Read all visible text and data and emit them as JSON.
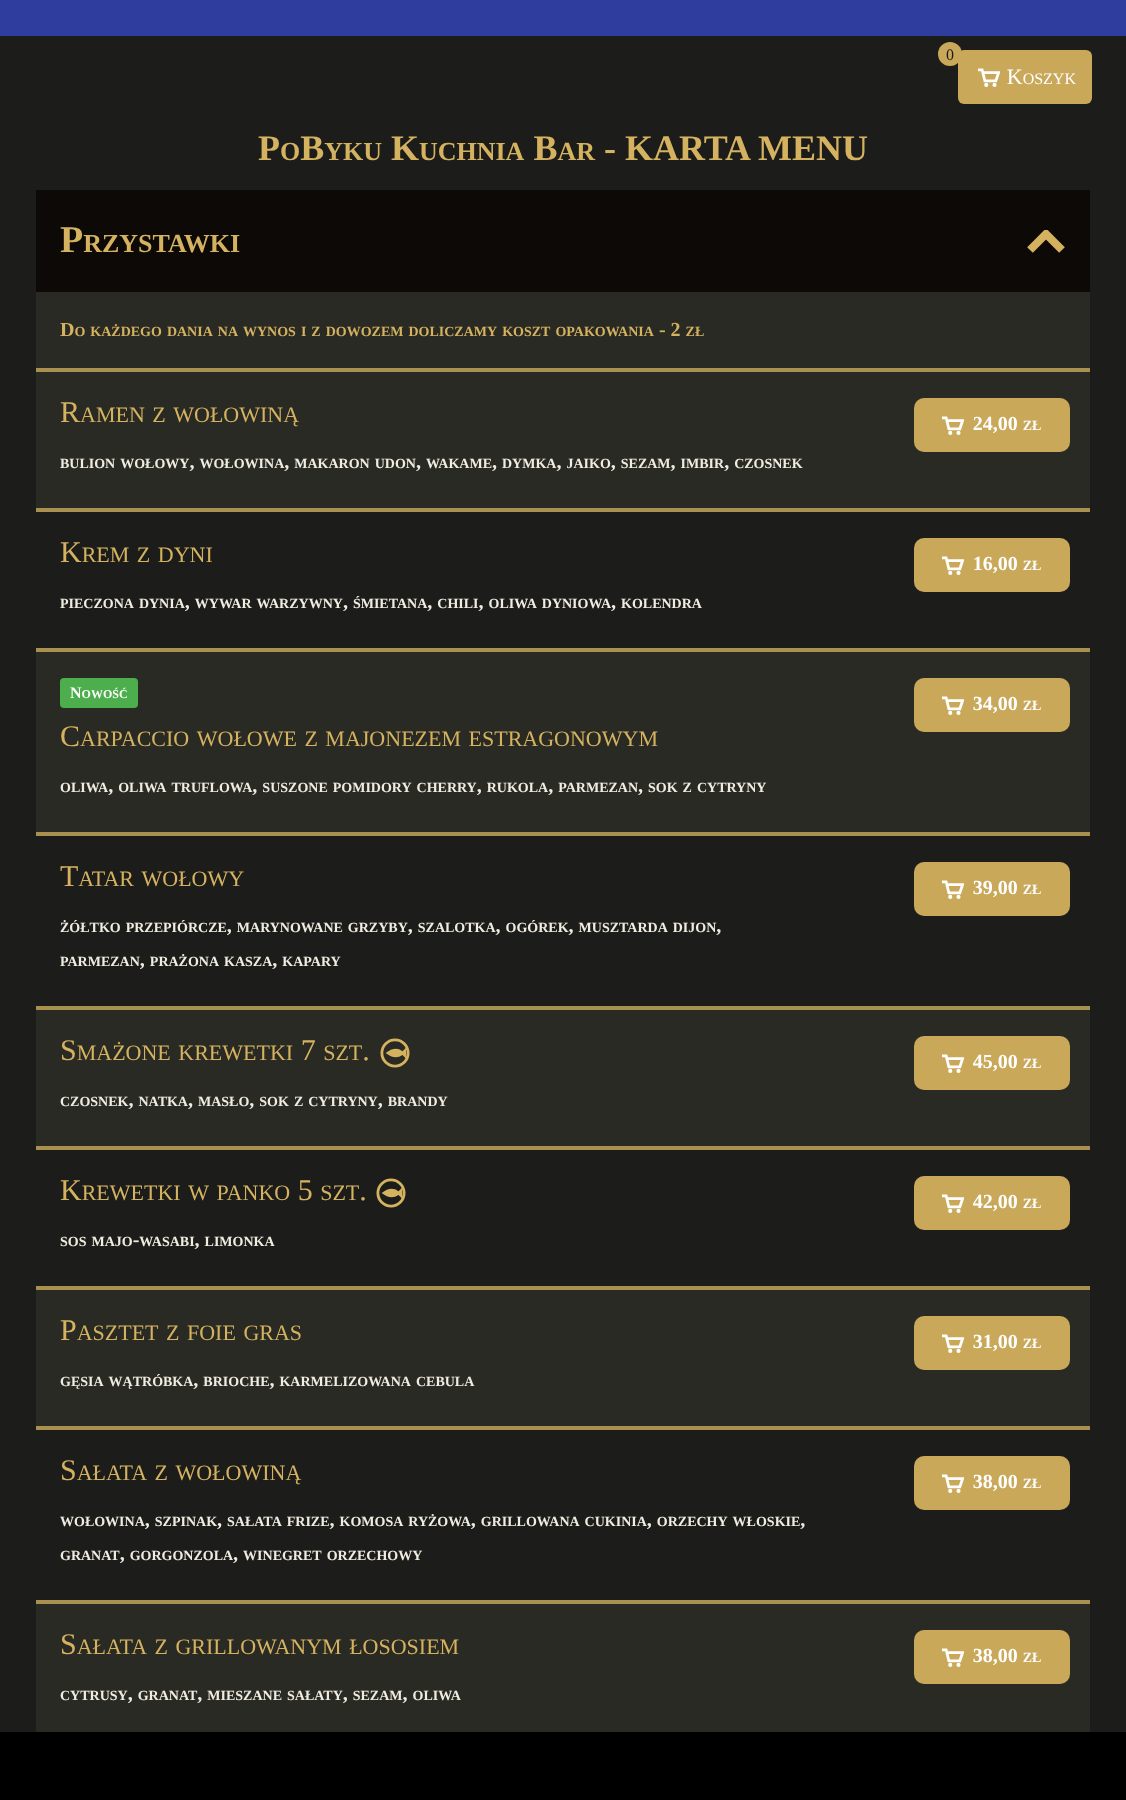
{
  "cart": {
    "count": "0",
    "label": "Koszyk"
  },
  "title": "PoByku Kuchnia Bar - KARTA MENU",
  "section": {
    "title": "Przystawki",
    "expanded": true,
    "notice": "Do każdego dania na wynos i z dowozem doliczamy koszt opakowania - 2 zł"
  },
  "items": [
    {
      "name": "Ramen z wołowiną",
      "ingredients": "bulion wołowy, wołowina, makaron udon, wakame, dymka, jaiko, sezam, imbir, czosnek",
      "price": "24,00 zł",
      "shrimp_icon": false
    },
    {
      "name": "Krem z dyni",
      "ingredients": "pieczona dynia, wywar warzywny, śmietana, chili, oliwa dyniowa, kolendra",
      "price": "16,00 zł",
      "shrimp_icon": false
    },
    {
      "badge": "Nowość",
      "name": "Carpaccio wołowe z majonezem estragonowym",
      "ingredients": "oliwa, oliwa truflowa, suszone pomidory cherry, rukola, parmezan, sok z cytryny",
      "price": "34,00 zł",
      "shrimp_icon": false
    },
    {
      "name": "Tatar wołowy",
      "ingredients": "żółtko przepiórcze, marynowane grzyby, szalotka, ogórek, musztarda dijon, parmezan, prażona kasza, kapary",
      "price": "39,00 zł",
      "shrimp_icon": false
    },
    {
      "name": "Smażone krewetki 7 szt.",
      "ingredients": "czosnek, natka, masło, sok z cytryny, brandy",
      "price": "45,00 zł",
      "shrimp_icon": true
    },
    {
      "name": "Krewetki w panko 5 szt.",
      "ingredients": "sos majo-wasabi, limonka",
      "price": "42,00 zł",
      "shrimp_icon": true
    },
    {
      "name": "Pasztet z foie gras",
      "ingredients": "gęsia wątróbka, brioche, karmelizowana cebula",
      "price": "31,00 zł",
      "shrimp_icon": false
    },
    {
      "name": "Sałata z wołowiną",
      "ingredients": "wołowina, szpinak, sałata frize, komosa ryżowa, grillowana cukinia, orzechy włoskie, granat, gorgonzola, winegret orzechowy",
      "price": "38,00 zł",
      "shrimp_icon": false
    },
    {
      "name": "Sałata z grillowanym łososiem",
      "ingredients": "cytrusy, granat, mieszane sałaty, sezam, oliwa",
      "price": "38,00 zł",
      "shrimp_icon": false
    }
  ]
}
